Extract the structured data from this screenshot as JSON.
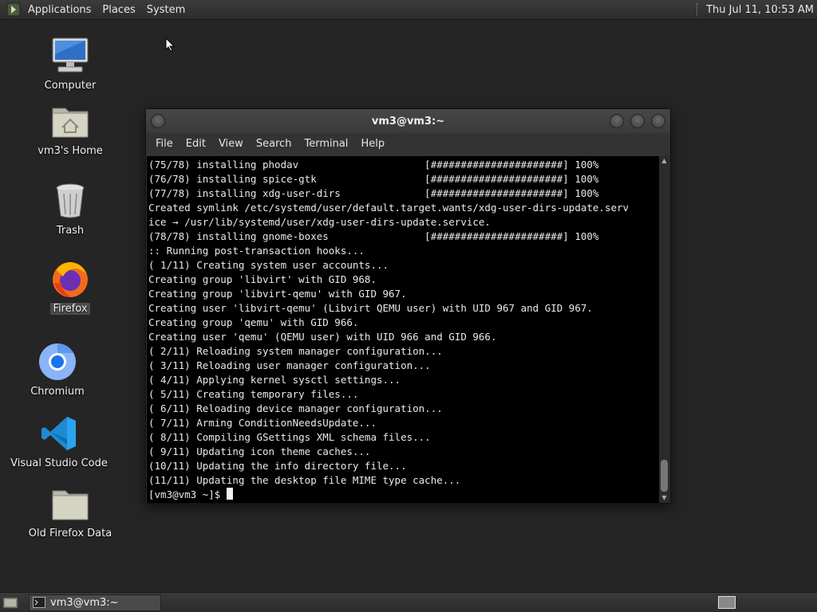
{
  "top_panel": {
    "menus": [
      "Applications",
      "Places",
      "System"
    ],
    "clock": "Thu Jul 11, 10:53 AM"
  },
  "desktop": {
    "icons": [
      {
        "label": "Computer",
        "icon": "computer-icon"
      },
      {
        "label": "vm3's Home",
        "icon": "home-folder-icon"
      },
      {
        "label": "Trash",
        "icon": "trash-icon"
      },
      {
        "label": "Firefox",
        "icon": "firefox-icon"
      },
      {
        "label": "Chromium",
        "icon": "chromium-icon"
      },
      {
        "label": "Visual Studio Code",
        "icon": "vscode-icon"
      },
      {
        "label": "Old Firefox Data",
        "icon": "folder-icon"
      }
    ]
  },
  "terminal_window": {
    "title": "vm3@vm3:~",
    "menus": [
      "File",
      "Edit",
      "View",
      "Search",
      "Terminal",
      "Help"
    ],
    "lines": [
      "(75/78) installing phodav                     [######################] 100%",
      "(76/78) installing spice-gtk                  [######################] 100%",
      "(77/78) installing xdg-user-dirs              [######################] 100%",
      "Created symlink /etc/systemd/user/default.target.wants/xdg-user-dirs-update.serv",
      "ice → /usr/lib/systemd/user/xdg-user-dirs-update.service.",
      "(78/78) installing gnome-boxes                [######################] 100%",
      ":: Running post-transaction hooks...",
      "( 1/11) Creating system user accounts...",
      "Creating group 'libvirt' with GID 968.",
      "Creating group 'libvirt-qemu' with GID 967.",
      "Creating user 'libvirt-qemu' (Libvirt QEMU user) with UID 967 and GID 967.",
      "Creating group 'qemu' with GID 966.",
      "Creating user 'qemu' (QEMU user) with UID 966 and GID 966.",
      "( 2/11) Reloading system manager configuration...",
      "( 3/11) Reloading user manager configuration...",
      "( 4/11) Applying kernel sysctl settings...",
      "( 5/11) Creating temporary files...",
      "( 6/11) Reloading device manager configuration...",
      "( 7/11) Arming ConditionNeedsUpdate...",
      "( 8/11) Compiling GSettings XML schema files...",
      "( 9/11) Updating icon theme caches...",
      "(10/11) Updating the info directory file...",
      "(11/11) Updating the desktop file MIME type cache..."
    ],
    "prompt": "[vm3@vm3 ~]$ "
  },
  "bottom_panel": {
    "task_label": "vm3@vm3:~"
  },
  "colors": {
    "desktop_bg": "#252525",
    "terminal_bg": "#000000",
    "terminal_fg": "#e9e9e9"
  }
}
